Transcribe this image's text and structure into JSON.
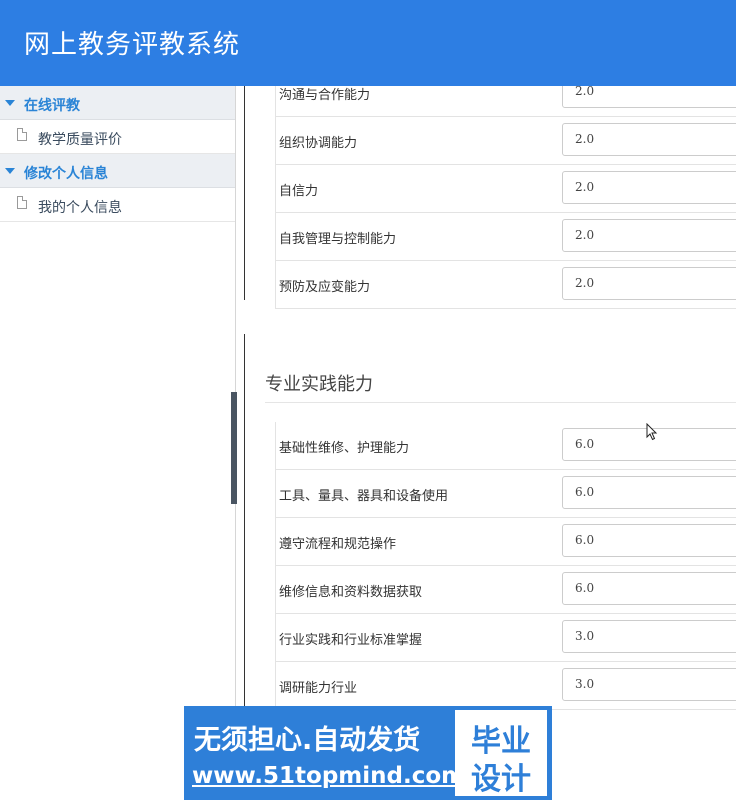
{
  "header": {
    "title": "网上教务评教系统"
  },
  "sidebar": {
    "groups": [
      {
        "label": "在线评教",
        "items": [
          {
            "label": "教学质量评价"
          }
        ]
      },
      {
        "label": "修改个人信息",
        "items": [
          {
            "label": "我的个人信息"
          }
        ]
      }
    ]
  },
  "section1": {
    "rows": [
      {
        "label": "沟通与合作能力",
        "value": "2.0"
      },
      {
        "label": "组织协调能力",
        "value": "2.0"
      },
      {
        "label": "自信力",
        "value": "2.0"
      },
      {
        "label": "自我管理与控制能力",
        "value": "2.0"
      },
      {
        "label": "预防及应变能力",
        "value": "2.0"
      }
    ]
  },
  "section2": {
    "title": "专业实践能力",
    "rows": [
      {
        "label": "基础性维修、护理能力",
        "value": "6.0"
      },
      {
        "label": "工具、量具、器具和设备使用",
        "value": "6.0"
      },
      {
        "label": "遵守流程和规范操作",
        "value": "6.0"
      },
      {
        "label": "维修信息和资料数据获取",
        "value": "6.0"
      },
      {
        "label": "行业实践和行业标准掌握",
        "value": "3.0"
      },
      {
        "label": "调研能力行业",
        "value": "3.0"
      }
    ]
  },
  "watermark": {
    "line1": "无须担心.自动发货",
    "line2": "www.51topmind.com",
    "badge_line1": "毕业",
    "badge_line2": "设计"
  },
  "colors": {
    "header": "#2d7ee3",
    "accent": "#2a84d6",
    "watermark": "#2e7fd8"
  }
}
